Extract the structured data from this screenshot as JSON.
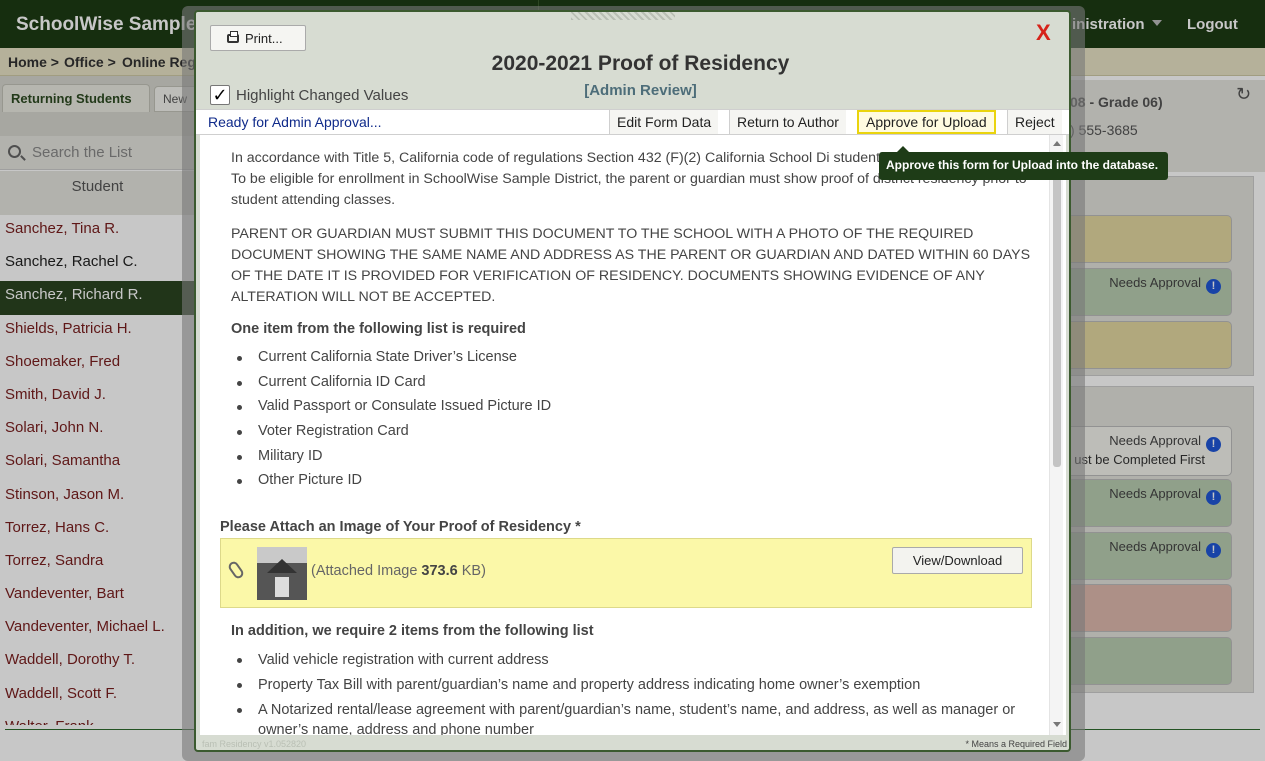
{
  "app": {
    "title": "SchoolWise Sample",
    "nav_admin": "inistration",
    "nav_logout": "Logout"
  },
  "breadcrumb": [
    "Home >",
    "Office >",
    "Online Reg"
  ],
  "left": {
    "tab_active": "Returning Students",
    "tab_new": "New",
    "search_placeholder": "Search the List",
    "column_header": "Student",
    "students": [
      {
        "name": "Sanchez, Tina R.",
        "state": "normal"
      },
      {
        "name": "Sanchez, Rachel C.",
        "state": "plain"
      },
      {
        "name": "Sanchez, Richard R.",
        "state": "selected"
      },
      {
        "name": "Shields, Patricia H.",
        "state": "normal"
      },
      {
        "name": "Shoemaker, Fred",
        "state": "normal"
      },
      {
        "name": "Smith, David J.",
        "state": "normal"
      },
      {
        "name": "Solari, John N.",
        "state": "normal"
      },
      {
        "name": "Solari, Samantha",
        "state": "normal"
      },
      {
        "name": "Stinson, Jason M.",
        "state": "normal"
      },
      {
        "name": "Torrez, Hans C.",
        "state": "normal"
      },
      {
        "name": "Torrez, Sandra",
        "state": "normal"
      },
      {
        "name": "Vandeventer, Bart",
        "state": "normal"
      },
      {
        "name": "Vandeventer, Michael L.",
        "state": "normal"
      },
      {
        "name": "Waddell, Dorothy T.",
        "state": "normal"
      },
      {
        "name": "Waddell, Scott F.",
        "state": "normal"
      },
      {
        "name": "Walter, Frank",
        "state": "normal"
      }
    ]
  },
  "right": {
    "header_line1": "08 - Grade 06)",
    "header_line2": ") 555-3685",
    "needs_approval": "Needs Approval",
    "must_complete": "ust be Completed First"
  },
  "modal": {
    "print_label": "Print...",
    "close_label": "X",
    "title": "2020-2021 Proof of Residency",
    "subtitle": "[Admin Review]",
    "highlight_label": "Highlight Changed Values",
    "status": "Ready for Admin Approval...",
    "buttons": {
      "edit": "Edit Form Data",
      "return": "Return to Author",
      "approve": "Approve for Upload",
      "reject": "Reject"
    },
    "tooltip": "Approve this form for Upload into the database.",
    "para1": "In accordance with Title 5, California code of regulations Section 432 (F)(2) California School Di students residency ANNUALLY. To be eligible for enrollment in SchoolWise Sample District, the parent or guardian must show proof of district residency prior to student attending classes.",
    "para2": "PARENT OR GUARDIAN MUST SUBMIT THIS DOCUMENT TO THE SCHOOL WITH A PHOTO OF THE REQUIRED DOCUMENT SHOWING THE SAME NAME AND ADDRESS AS THE PARENT OR GUARDIAN AND DATED WITHIN 60 DAYS OF THE DATE IT IS PROVIDED FOR VERIFICATION OF RESIDENCY. DOCUMENTS SHOWING EVIDENCE OF ANY ALTERATION WILL NOT BE ACCEPTED.",
    "list1_heading": "One item from the following list is required",
    "list1": [
      "Current California State Driver’s License",
      "Current California ID Card",
      "Valid Passport or Consulate Issued Picture ID",
      "Voter Registration Card",
      "Military ID",
      "Other Picture ID"
    ],
    "attach_label": "Please Attach an Image of Your Proof of Residency *",
    "attach_prefix": "(Attached Image ",
    "attach_size": "373.6",
    "attach_suffix": " KB)",
    "view_download": "View/Download",
    "list2_heading": "In addition, we require 2 items from the following list",
    "list2": [
      "Valid vehicle registration with current address",
      "Property Tax Bill with parent/guardian’s name and property address indicating home owner’s exemption",
      "A Notarized rental/lease agreement with parent/guardian’s name, student’s name, and address, as well as manager or owner’s name, address and phone number"
    ],
    "version": "fam Residency v1.052820",
    "required_note": "* Means a Required Field"
  },
  "colors": {
    "top_bar": "#1d3b14",
    "selected_row": "#2b4521",
    "close": "#d6231a",
    "approve_highlight": "#ead40d",
    "attach_bg": "#fbf8a8"
  }
}
